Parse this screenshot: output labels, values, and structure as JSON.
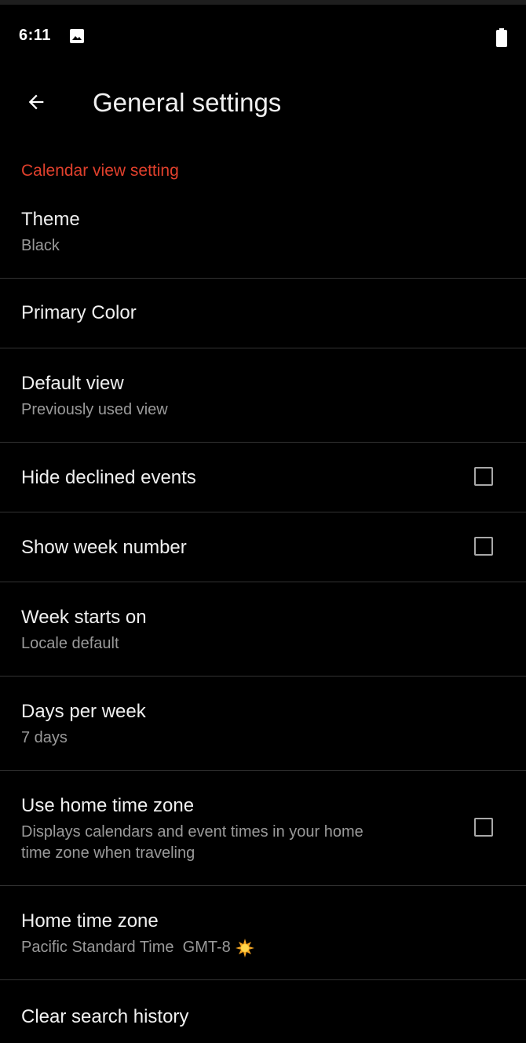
{
  "status_bar": {
    "time": "6:11"
  },
  "app_bar": {
    "title": "General settings"
  },
  "section": {
    "header": "Calendar view setting"
  },
  "items": [
    {
      "label": "Theme",
      "sub": "Black"
    },
    {
      "label": "Primary Color"
    },
    {
      "label": "Default view",
      "sub": "Previously used view"
    },
    {
      "label": "Hide declined events",
      "checked": false
    },
    {
      "label": "Show week number",
      "checked": false
    },
    {
      "label": "Week starts on",
      "sub": "Locale default"
    },
    {
      "label": "Days per week",
      "sub": "7 days"
    },
    {
      "label": "Use home time zone",
      "sub_line1": "Displays calendars and event times in your home",
      "sub_line2": "time zone when traveling",
      "checked": false
    },
    {
      "label": "Home time zone",
      "sub": "Pacific Standard Time  GMT-8"
    },
    {
      "label": "Clear search history"
    }
  ],
  "colors": {
    "accent": "#e0402c",
    "background": "#000000",
    "divider": "#333333"
  }
}
